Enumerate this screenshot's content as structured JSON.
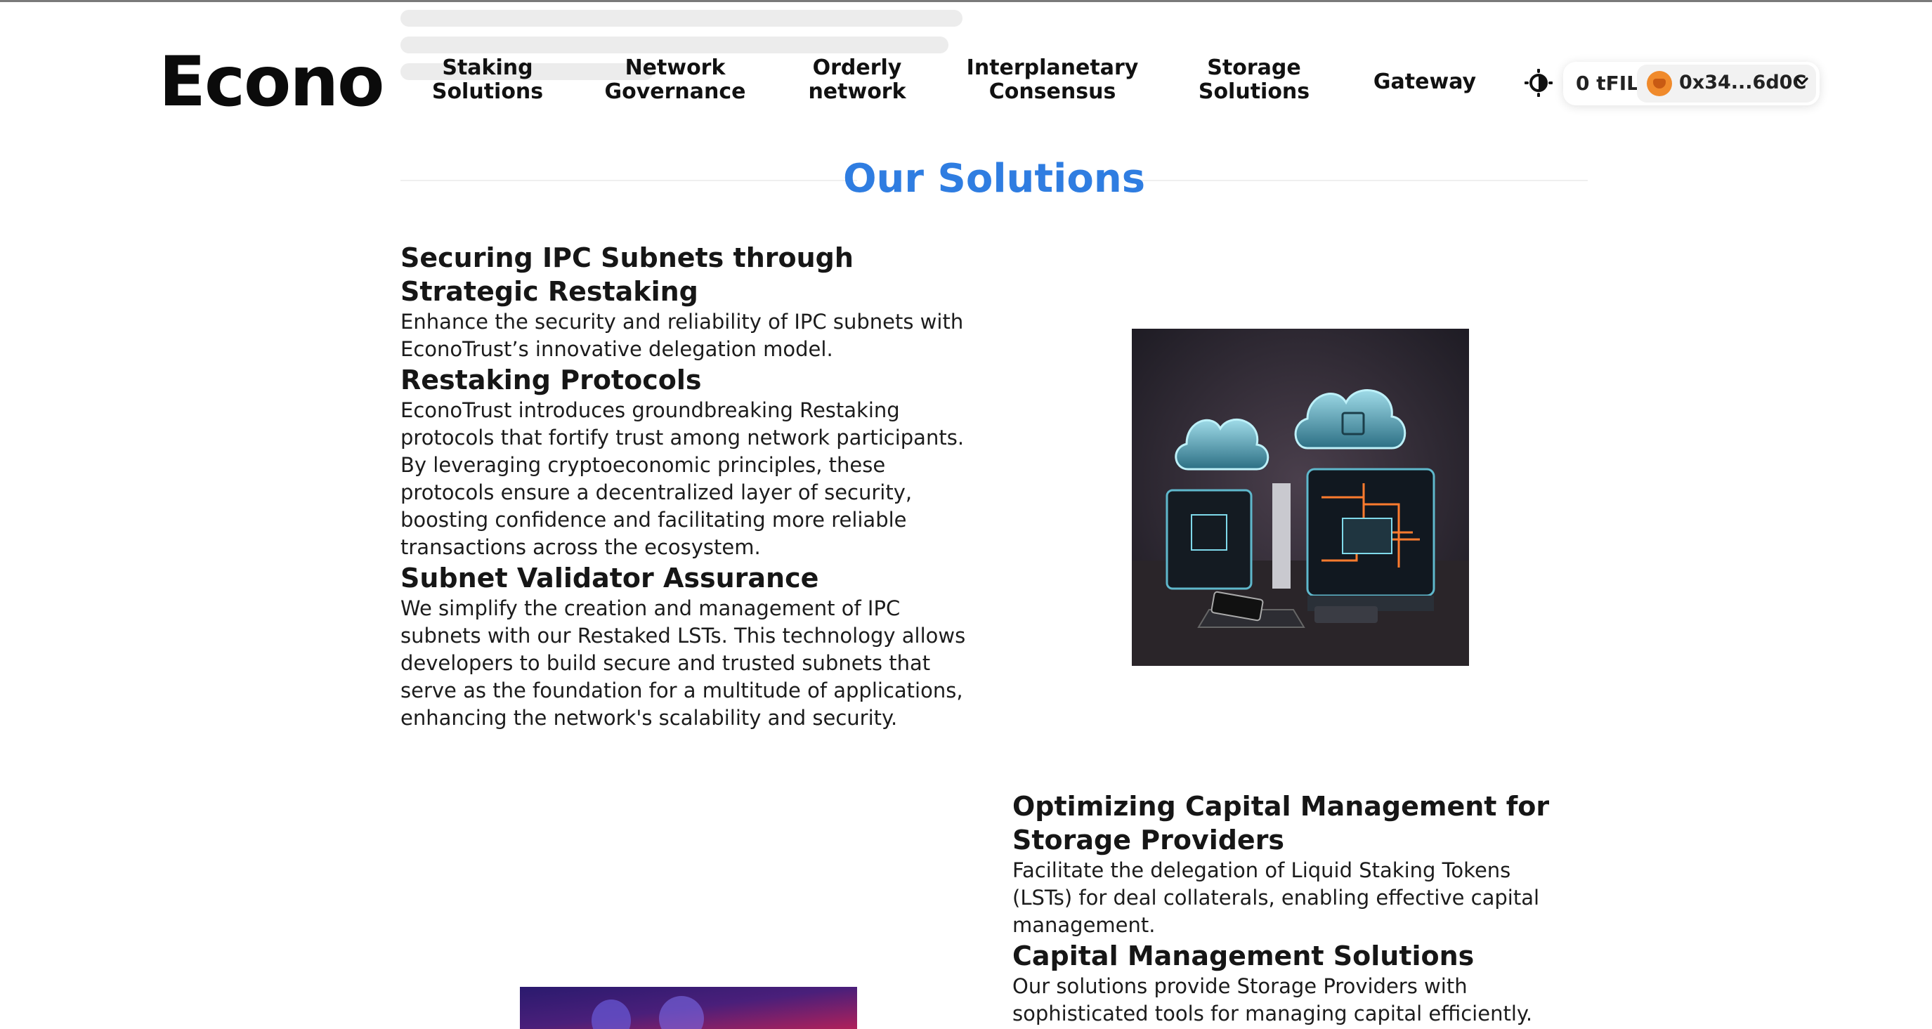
{
  "brand": {
    "logo_text": "Econo"
  },
  "nav": {
    "items": [
      {
        "label": "Staking\nSolutions"
      },
      {
        "label": "Network\nGovernance"
      },
      {
        "label": "Orderly\nnetwork"
      },
      {
        "label": "Interplanetary\nConsensus"
      },
      {
        "label": "Storage\nSolutions"
      },
      {
        "label": "Gateway"
      }
    ]
  },
  "wallet": {
    "balance": "0 tFIL",
    "address": "0x34...6d0C"
  },
  "icons": {
    "theme_toggle": "sun-moon-icon",
    "account": "metamask-fox-icon",
    "dropdown": "chevron-down-icon"
  },
  "colors": {
    "accent": "#2f7de1",
    "text": "#111111",
    "background": "#ffffff"
  },
  "section": {
    "title": "Our Solutions"
  },
  "solutions": [
    {
      "title": "Securing IPC Subnets through Strategic Restaking",
      "intro": "Enhance the security and reliability of IPC subnets with EconoTrust’s innovative delegation model.",
      "subsections": [
        {
          "heading": "Restaking Protocols",
          "body": "EconoTrust introduces groundbreaking Restaking protocols that fortify trust among network participants. By leveraging cryptoeconomic principles, these protocols ensure a decentralized layer of security, boosting confidence and facilitating more reliable transactions across the ecosystem."
        },
        {
          "heading": "Subnet Validator Assurance",
          "body": "We simplify the creation and management of IPC subnets with our Restaked LSTs. This technology allows developers to build secure and trusted subnets that serve as the foundation for a multitude of applications, enhancing the network's scalability and security."
        }
      ]
    },
    {
      "title": "Optimizing Capital Management for Storage Providers",
      "intro": "Facilitate the delegation of Liquid Staking Tokens (LSTs) for deal collaterals, enabling effective capital management.",
      "subsections": [
        {
          "heading": "Capital Management Solutions",
          "body": "Our solutions provide Storage Providers with sophisticated tools for managing capital efficiently."
        }
      ]
    }
  ]
}
